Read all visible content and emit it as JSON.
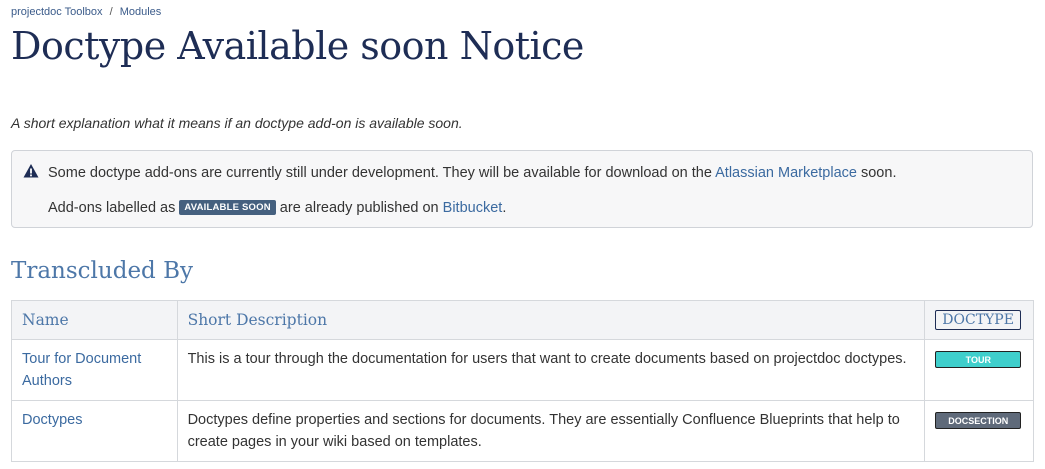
{
  "breadcrumb": {
    "parent": "projectdoc Toolbox",
    "separator": "/",
    "current": "Modules"
  },
  "page_title": "Doctype Available soon Notice",
  "summary": "A short explanation what it means if an doctype add-on is available soon.",
  "notice": {
    "icon": "warning-icon",
    "line1_before": "Some doctype add-ons are currently still under development. They will be available for download on the ",
    "line1_link": "Atlassian Marketplace",
    "line1_after": " soon.",
    "line2_before": "Add-ons labelled as ",
    "badge": "AVAILABLE SOON",
    "line2_middle": " are already published on ",
    "line2_link": "Bitbucket",
    "line2_after": "."
  },
  "section_title": "Transcluded By",
  "table": {
    "headers": {
      "name": "Name",
      "description": "Short Description",
      "doctype": "DOCTYPE"
    },
    "rows": [
      {
        "name": "Tour for Document Authors",
        "description": "This is a tour through the documentation for users that want to create documents based on projectdoc doctypes.",
        "doctype": "TOUR",
        "doctype_color": "#3fcfcc"
      },
      {
        "name": "Doctypes",
        "description": "Doctypes define properties and sections for documents. They are essentially Confluence Blueprints that help to create pages in your wiki based on templates.",
        "doctype": "DOCSECTION",
        "doctype_color": "#5f6a7a"
      }
    ]
  },
  "colors": {
    "accent": "#4d77a8",
    "title": "#1e2d55",
    "badge": "#45607f"
  }
}
